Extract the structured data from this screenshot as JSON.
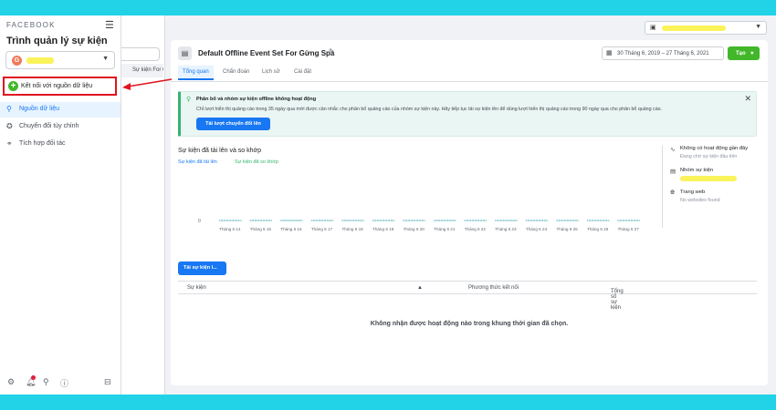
{
  "sidebar": {
    "brand": "FACEBOOK",
    "title": "Trình quản lý sự kiện",
    "account_initial": "G",
    "connect_label": "Kết nối với nguồn dữ liệu",
    "nav": [
      {
        "label": "Nguồn dữ liệu",
        "icon": "data-sources-icon",
        "active": true
      },
      {
        "label": "Chuyển đổi tùy chỉnh",
        "icon": "custom-conversion-icon",
        "active": false
      },
      {
        "label": "Tích hợp đối tác",
        "icon": "partner-integration-icon",
        "active": false
      }
    ]
  },
  "source_list": {
    "item": "Sự kiện For Gừng S..."
  },
  "header": {
    "title": "Default Offline Event Set For Gừng Spa",
    "date_range": "30 Tháng 6, 2019 – 27 Tháng 6, 2021",
    "create_label": "Tạo",
    "tabs": [
      "Tổng quan",
      "Chẩn đoán",
      "Lịch sử",
      "Cài đặt"
    ]
  },
  "banner": {
    "title": "Phân bổ và nhóm sự kiện offline không hoạt động",
    "description": "Chỉ lượt hiển thị quảng cáo trong 35 ngày qua mới được cân nhắc cho phân bổ quảng cáo của nhóm sự kiện này. Hãy tiếp tục tải sự kiện lên để dùng lượt hiển thị quảng cáo trong 90 ngày qua cho phân bổ quảng cáo.",
    "button": "Tải lượt chuyển đổi lên"
  },
  "chart_data": {
    "type": "line",
    "title": "Sự kiện đã tải lên và so khớp",
    "xlabel": "",
    "ylabel": "",
    "categories": [
      "Tháng 6 14",
      "Tháng 6 15",
      "Tháng 6 16",
      "Tháng 6 17",
      "Tháng 6 18",
      "Tháng 6 19",
      "Tháng 6 20",
      "Tháng 6 21",
      "Tháng 6 22",
      "Tháng 6 23",
      "Tháng 6 24",
      "Tháng 6 25",
      "Tháng 6 26",
      "Tháng 6 27"
    ],
    "y_tick": "0",
    "ylim": [
      0,
      1
    ],
    "series": [
      {
        "name": "Sự kiện đã tải lên",
        "color": "#1877f2",
        "values": [
          0,
          0,
          0,
          0,
          0,
          0,
          0,
          0,
          0,
          0,
          0,
          0,
          0,
          0
        ]
      },
      {
        "name": "Sự kiện đã so khớp",
        "color": "#34b46f",
        "values": [
          0,
          0,
          0,
          0,
          0,
          0,
          0,
          0,
          0,
          0,
          0,
          0,
          0,
          0
        ]
      }
    ]
  },
  "side_panel": [
    {
      "title": "Không có hoạt động gần đây",
      "subtitle": "Đang chờ sự kiện đầu tiên",
      "icon": "activity-icon"
    },
    {
      "title": "Nhóm sự kiện",
      "subtitle": "",
      "icon": "event-set-icon"
    },
    {
      "title": "Trang web",
      "subtitle": "No websites found",
      "icon": "globe-icon"
    }
  ],
  "upload_button": "Tải sự kiện l...",
  "table": {
    "columns": [
      "Sự kiện",
      "Phương thức kết nối",
      "Tổng số sự kiện"
    ],
    "empty_message": "Không nhận được hoạt động nào trong khung thời gian đã chọn."
  },
  "colors": {
    "accent": "#1877f2",
    "green": "#42b72a",
    "highlight": "#fbf35a",
    "annotation": "#e0141e"
  }
}
